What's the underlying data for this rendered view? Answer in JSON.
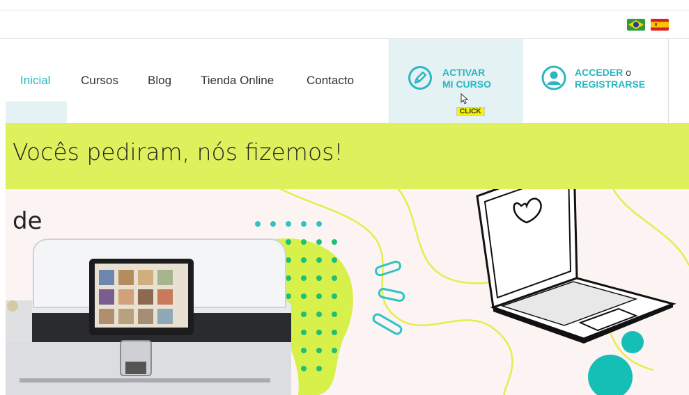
{
  "flags": [
    "brazil-flag-icon",
    "spain-flag-icon"
  ],
  "nav": {
    "items": [
      {
        "label": "Inicial",
        "active": true
      },
      {
        "label": "Cursos",
        "active": false
      },
      {
        "label": "Blog",
        "active": false
      },
      {
        "label": "Tienda Online",
        "active": false
      },
      {
        "label": "Contacto",
        "active": false
      }
    ]
  },
  "cta": {
    "activar_line1": "ACTIVAR",
    "activar_line2": "MI CURSO",
    "click_tag": "CLICK",
    "acceder": "ACCEDER",
    "o": "o",
    "registrarse": "REGISTRARSE"
  },
  "banner": {
    "text": "Vocês pediram, nós fizemos!"
  },
  "hero": {
    "text": "de"
  },
  "colors": {
    "accent": "#2bb6c0",
    "banner": "#dff05d",
    "hero_bg": "#fcf3f3",
    "teal_dots": "#2ec4c4",
    "green_blob": "#d8f04a"
  }
}
